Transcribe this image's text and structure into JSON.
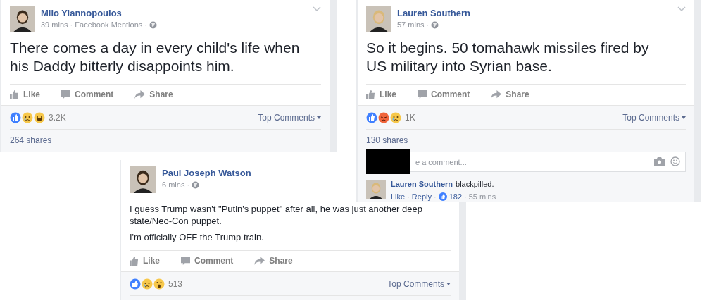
{
  "posts": [
    {
      "author": "Milo Yiannopoulos",
      "meta": "39 mins · Facebook Mentions ·",
      "kind": "headline",
      "paragraphs": [
        "There comes a day in every child's life when his Daddy bitterly disappoints him."
      ],
      "actions": [
        "Like",
        "Comment",
        "Share"
      ],
      "reactions": [
        {
          "kind": "like"
        },
        {
          "kind": "sad"
        },
        {
          "kind": "haha"
        }
      ],
      "reaction_count": "3.2K",
      "sort_label": "Top Comments",
      "shares": "264 shares"
    },
    {
      "author": "Lauren Southern",
      "meta": "57 mins ·",
      "kind": "headline",
      "paragraphs": [
        "So it begins. 50 tomahawk missiles fired by US military into Syrian base."
      ],
      "actions": [
        "Like",
        "Comment",
        "Share"
      ],
      "reactions": [
        {
          "kind": "like"
        },
        {
          "kind": "angry"
        },
        {
          "kind": "sad"
        }
      ],
      "reaction_count": "1K",
      "sort_label": "Top Comments",
      "shares": "130 shares",
      "comment_field": {
        "placeholder": "e a comment..."
      },
      "comment": {
        "author": "Lauren Southern",
        "text": "blackpilled.",
        "footer": [
          {
            "kind": "link",
            "text": "Like"
          },
          {
            "kind": "sep",
            "text": "·"
          },
          {
            "kind": "link",
            "text": "Reply"
          },
          {
            "kind": "sep",
            "text": "·"
          },
          {
            "kind": "likes",
            "text": "182"
          },
          {
            "kind": "sep",
            "text": "·"
          },
          {
            "kind": "time",
            "text": "55 mins"
          }
        ]
      }
    },
    {
      "author": "Paul Joseph Watson",
      "meta": "6 mins ·",
      "kind": "body",
      "paragraphs": [
        "I guess Trump wasn't \"Putin's puppet\" after all, he was just another deep state/Neo-Con puppet.",
        "I'm officially OFF the Trump train."
      ],
      "actions": [
        "Like",
        "Comment",
        "Share"
      ],
      "reactions": [
        {
          "kind": "like"
        },
        {
          "kind": "sad"
        },
        {
          "kind": "wow"
        }
      ],
      "reaction_count": "513",
      "sort_label": "Top Comments"
    }
  ]
}
